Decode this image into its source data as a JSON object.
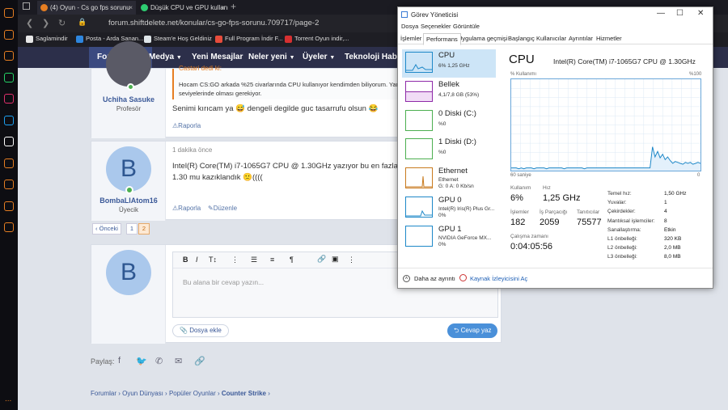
{
  "browser": {
    "tabs": [
      {
        "label": "(4) Oyun - Cs go fps sorunu",
        "color": "#c0392b"
      },
      {
        "label": "Düşük CPU ve GPU kullanımı",
        "color": "#2ecc71"
      }
    ],
    "new_tab": "+",
    "url": "forum.shiftdelete.net/konular/cs-go-fps-sorunu.709717/page-2",
    "bookmarks": [
      {
        "label": "Saglamindir",
        "color": "#e8e8e8"
      },
      {
        "label": "Posta - Arda Sanan...",
        "color": "#2e86de"
      },
      {
        "label": "Steam'e Hoş Geldiniz",
        "color": "#dfe6e9"
      },
      {
        "label": "Full Program İndir F...",
        "color": "#e74c3c"
      },
      {
        "label": "Torrent Oyun indir,...",
        "color": "#d63031"
      }
    ]
  },
  "sidebar": {
    "icons": [
      {
        "name": "home-icon",
        "color": "#e67e22"
      },
      {
        "name": "messenger-icon",
        "color": "#e67e22"
      },
      {
        "name": "twitch-icon",
        "color": "#e67e22"
      },
      {
        "name": "whatsapp-icon",
        "color": "#25d366"
      },
      {
        "name": "instagram-icon",
        "color": "#e1306c"
      },
      {
        "name": "twitter-icon",
        "color": "#1da1f2"
      },
      {
        "name": "discord-icon",
        "color": "#fff"
      },
      {
        "name": "clock-icon",
        "color": "#e67e22"
      },
      {
        "name": "download-icon",
        "color": "#e67e22"
      },
      {
        "name": "box-icon",
        "color": "#e67e22"
      },
      {
        "name": "settings-icon",
        "color": "#e67e22"
      }
    ],
    "more": "..."
  },
  "sitenav": {
    "items": [
      "Forumlar",
      "Medya",
      "Yeni Mesajlar",
      "Neler yeni",
      "Üyeler",
      "Teknoloji Haberleri"
    ]
  },
  "posts": [
    {
      "user": "Uchiha Sasuke",
      "role": "Profesör",
      "quote_header": "Castari dedi ki:",
      "quote_text": "Hocam CS:GO arkada %25 civarlarında CPU kullanıyor kendimden biliyorum. Yani normal değil en az 2.50 seviyelerinde olması gerekiyor.",
      "body": "Senimi kırıcam ya 😅 dengeli degilde guc tasarrufu olsun 😂",
      "report": "Raporla"
    },
    {
      "avatar_letter": "B",
      "user": "BombaLIAtom16",
      "role": "Üyecik",
      "time": "1 dakika önce",
      "body": "Intel(R) Core(TM) i7-1065G7 CPU @ 1.30GHz yazıyor bu en fazla 1.30 mu kazıklandık 🙁((((",
      "report": "Raporla",
      "edit": "Düzenle"
    }
  ],
  "pagination": {
    "prev": "‹ Önceki",
    "pages": [
      "1",
      "2"
    ]
  },
  "reply": {
    "avatar_letter": "B",
    "placeholder": "Bu alana bir cevap yazın...",
    "attach": "Dosya ekle",
    "submit": "Cevap yaz",
    "tools": [
      "B",
      "I",
      "T↕",
      "⋮",
      "☰",
      "≡",
      "¶",
      "🔗",
      "▣",
      "⋮"
    ]
  },
  "share": {
    "label": "Paylaş:"
  },
  "breadcrumb": [
    "Forumlar",
    "Oyun Dünyası",
    "Popüler Oyunlar",
    "Counter Strike"
  ],
  "taskmgr": {
    "title": "Görev Yöneticisi",
    "menu": [
      "Dosya",
      "Seçenekler",
      "Görüntüle"
    ],
    "tabs": [
      "İşlemler",
      "Performans",
      "Uygulama geçmişi",
      "Başlangıç",
      "Kullanıcılar",
      "Ayrıntılar",
      "Hizmetler"
    ],
    "items": [
      {
        "name": "CPU",
        "sub": "6% 1,25 GHz",
        "color": "#1e88c8"
      },
      {
        "name": "Bellek",
        "sub": "4,1/7,8 GB (53%)",
        "color": "#8e2aa8"
      },
      {
        "name": "0 Diski (C:)",
        "sub": "%0",
        "color": "#4caf50"
      },
      {
        "name": "1 Diski (D:)",
        "sub": "%0",
        "color": "#4caf50"
      },
      {
        "name": "Ethernet",
        "sub": "Ethernet",
        "sub2": "G: 0 A: 0 Kb/sn",
        "color": "#c87a1e"
      },
      {
        "name": "GPU 0",
        "sub": "Intel(R) Iris(R) Plus Gr...",
        "sub2": "0%",
        "color": "#1e88c8"
      },
      {
        "name": "GPU 1",
        "sub": "NVIDIA GeForce MX...",
        "sub2": "0%",
        "color": "#1e88c8"
      }
    ],
    "cpu": {
      "heading": "CPU",
      "model": "Intel(R) Core(TM) i7-1065G7 CPU @ 1.30GHz",
      "usage_label": "% Kullanımı",
      "usage_max": "%100",
      "time_label": "60 saniye",
      "zero": "0",
      "stats": [
        {
          "label": "Kullanım",
          "value": "6%"
        },
        {
          "label": "Hız",
          "value": "1,25 GHz"
        },
        {
          "label": "İşlemler",
          "value": "182"
        },
        {
          "label": "İş Parçacığı",
          "value": "2059"
        },
        {
          "label": "Tanıtıcılar",
          "value": "75577"
        },
        {
          "label": "Çalışma zamanı",
          "value": "0:04:05:56"
        }
      ],
      "specs": [
        {
          "k": "Temel hız:",
          "v": "1,50 GHz"
        },
        {
          "k": "Yuvalar:",
          "v": "1"
        },
        {
          "k": "Çekirdekler:",
          "v": "4"
        },
        {
          "k": "Mantıksal işlemciler:",
          "v": "8"
        },
        {
          "k": "Sanallaştırma:",
          "v": "Etkin"
        },
        {
          "k": "L1 önbelleği:",
          "v": "320 KB"
        },
        {
          "k": "L2 önbelleği:",
          "v": "2,0 MB"
        },
        {
          "k": "L3 önbelleği:",
          "v": "8,0 MB"
        }
      ],
      "graph": [
        3,
        3,
        3,
        2,
        3,
        2,
        3,
        3,
        3,
        2,
        3,
        3,
        3,
        3,
        2,
        3,
        3,
        3,
        3,
        3,
        3,
        2,
        3,
        3,
        3,
        3,
        3,
        3,
        3,
        2,
        3,
        3,
        3,
        3,
        3,
        3,
        3,
        3,
        3,
        3,
        3,
        3,
        3,
        3,
        3,
        3,
        3,
        3,
        3,
        3,
        3,
        3,
        3,
        3,
        3,
        3,
        26,
        15,
        21,
        14,
        18,
        12,
        15,
        11,
        8,
        10,
        9,
        8,
        7,
        9,
        8,
        9,
        7,
        8,
        9,
        8
      ]
    },
    "footer": {
      "less": "Daha az ayrıntı",
      "monitor": "Kaynak İzleyicisini Aç"
    }
  }
}
